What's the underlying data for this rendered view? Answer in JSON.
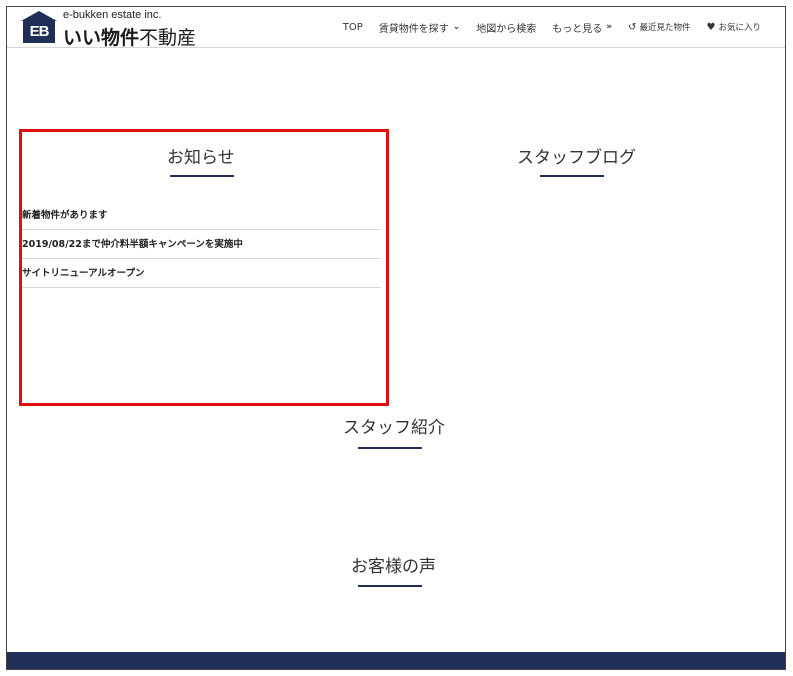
{
  "header": {
    "logo_mark": "EB",
    "logo_sub": "e-bukken estate inc.",
    "logo_main_bold": "いい物件",
    "logo_main_thin": "不動産",
    "nav": {
      "top": "TOP",
      "search_rent": "賃貸物件を探す",
      "map_search": "地図から検索",
      "more": "もっと見る",
      "recently_viewed": "最近見た物件",
      "favorites": "お気に入り"
    }
  },
  "sections": {
    "news_title": "お知らせ",
    "blog_title": "スタッフブログ",
    "staff_title": "スタッフ紹介",
    "voice_title": "お客様の声"
  },
  "news": [
    "新着物件があります",
    "2019/08/22まで仲介料半額キャンペーンを実施中",
    "サイトリニューアルオープン"
  ],
  "colors": {
    "navy": "#1f2f55",
    "highlight_border": "#e01010"
  }
}
